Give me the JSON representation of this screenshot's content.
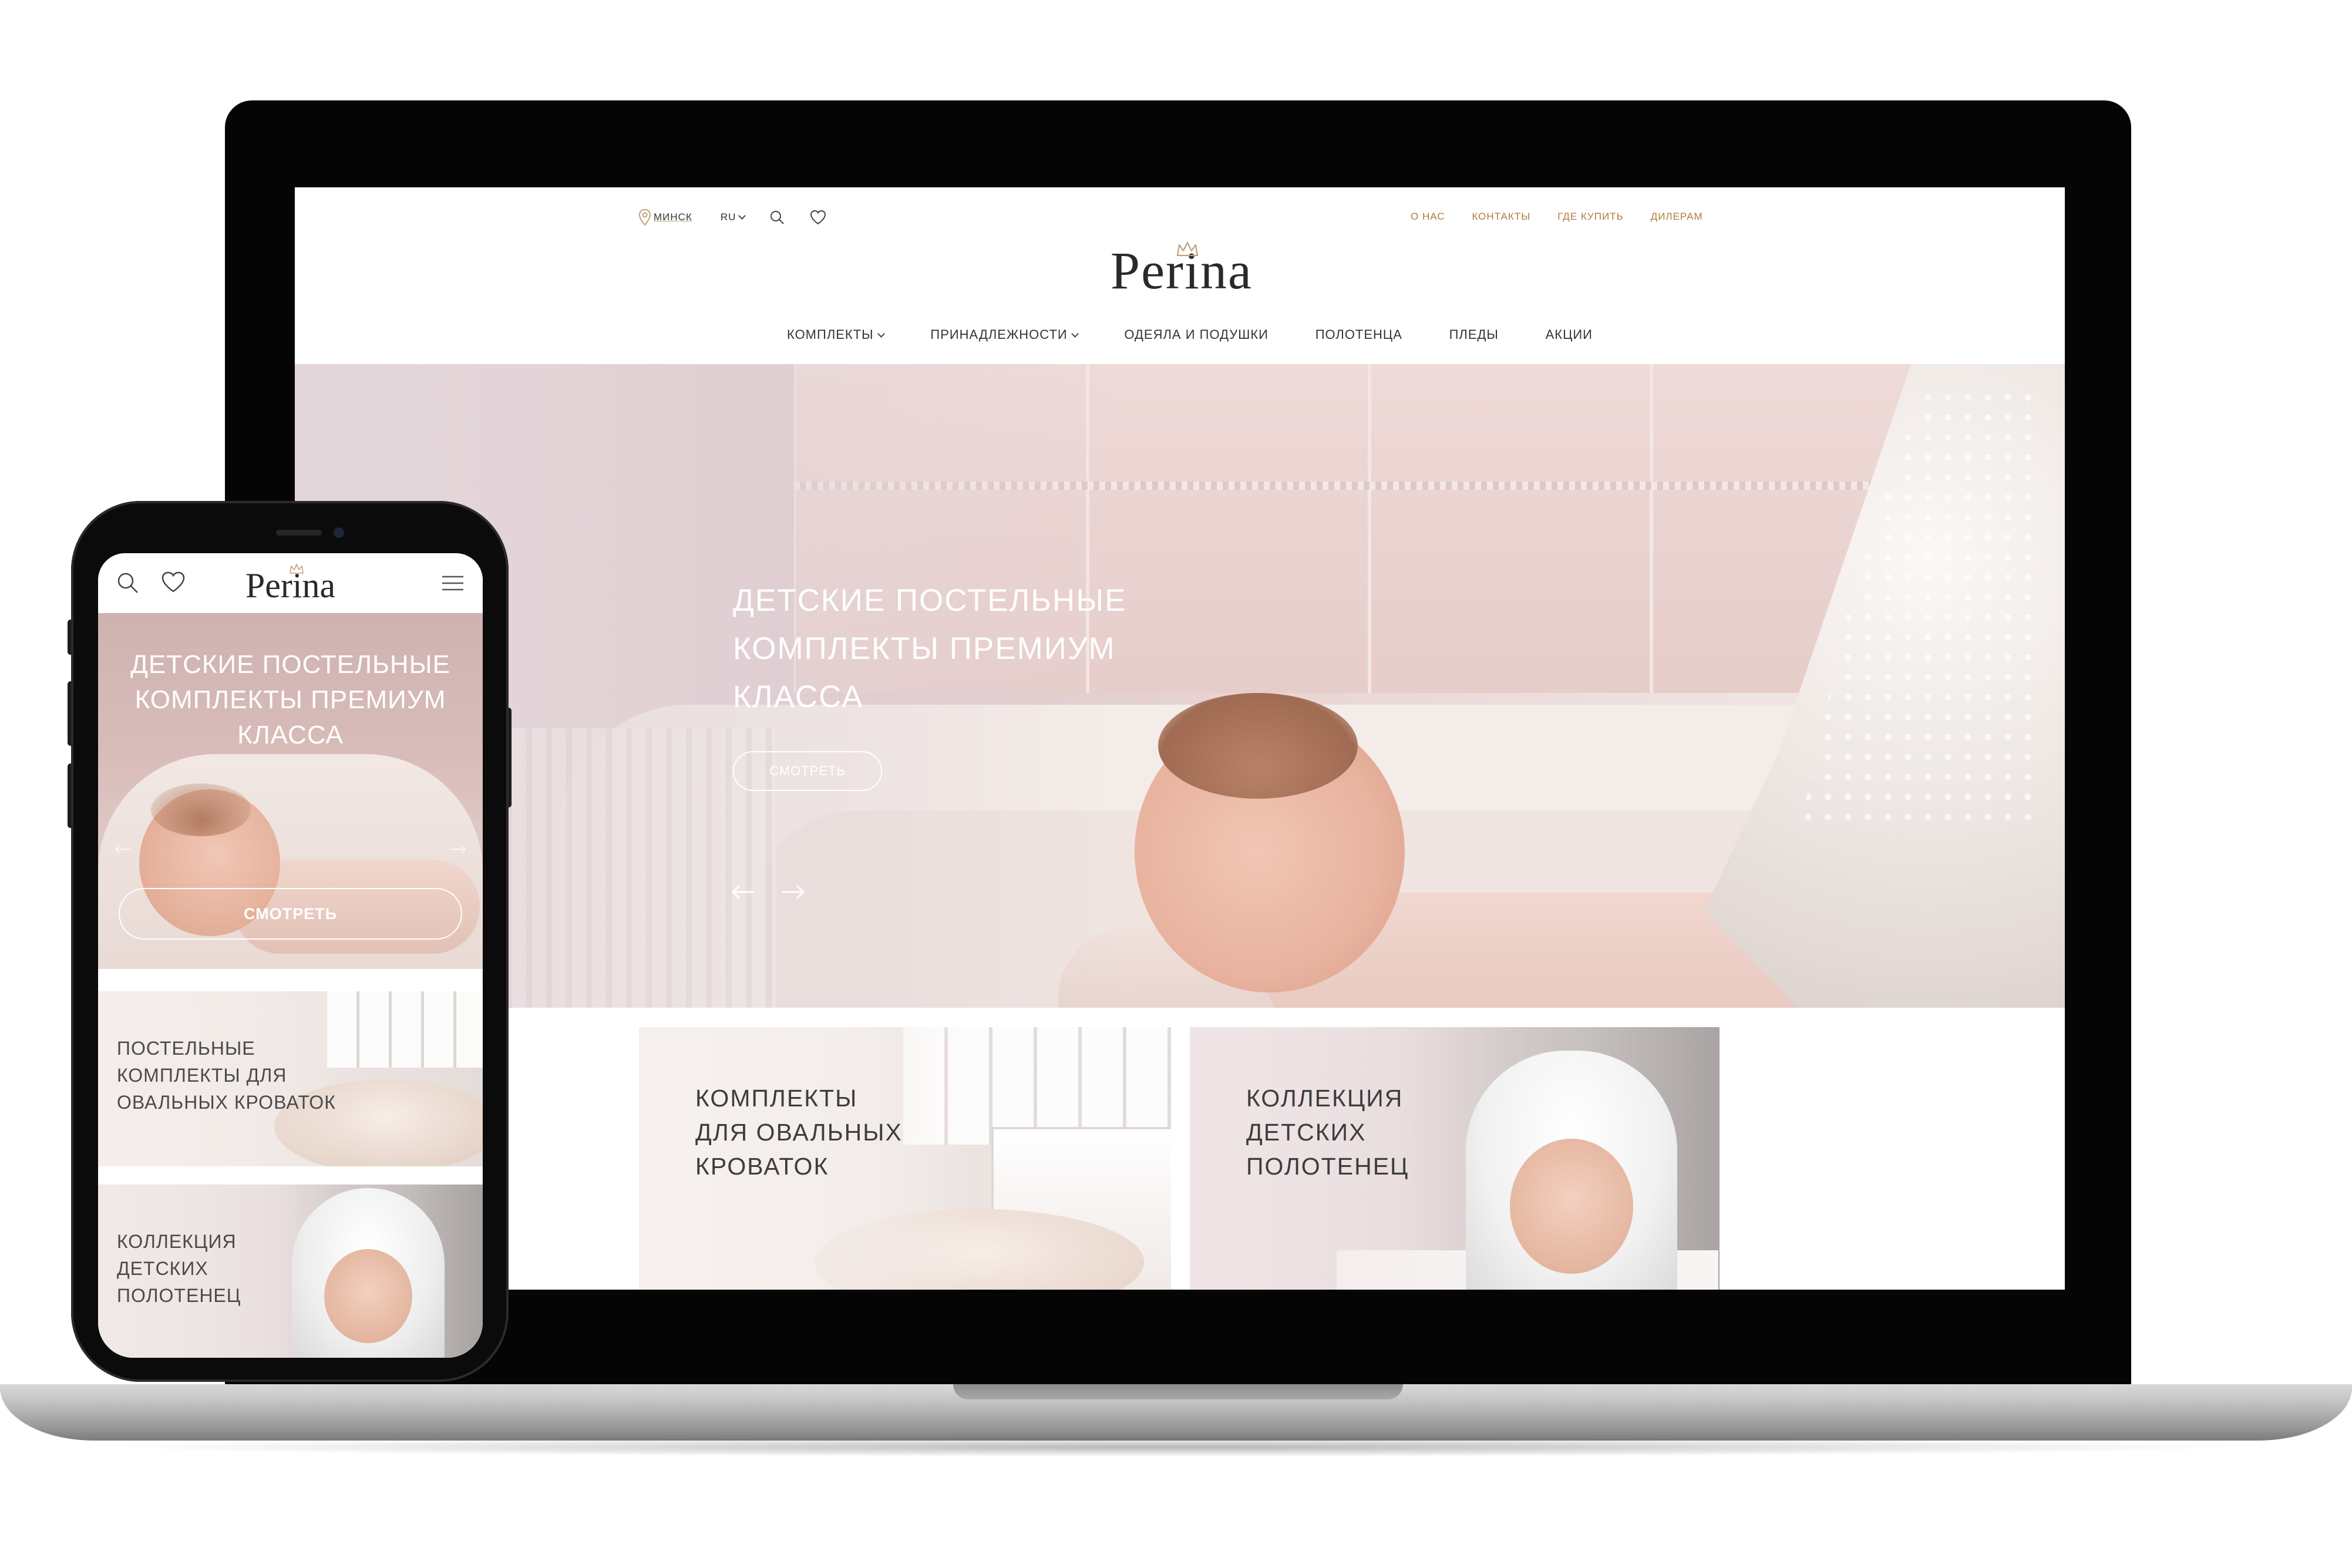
{
  "desktop": {
    "header": {
      "city": "МИНСК",
      "language": "RU",
      "links": [
        "О НАС",
        "КОНТАКТЫ",
        "ГДЕ КУПИТЬ",
        "ДИЛЕРАМ"
      ]
    },
    "logo": "Perina",
    "nav": [
      {
        "label": "КОМПЛЕКТЫ",
        "dropdown": true
      },
      {
        "label": "ПРИНАДЛЕЖНОСТИ",
        "dropdown": true
      },
      {
        "label": "ОДЕЯЛА И ПОДУШКИ",
        "dropdown": false
      },
      {
        "label": "ПОЛОТЕНЦА",
        "dropdown": false
      },
      {
        "label": "ПЛЕДЫ",
        "dropdown": false
      },
      {
        "label": "АКЦИИ",
        "dropdown": false
      }
    ],
    "hero": {
      "title_lines": [
        "ДЕТСКИЕ ПОСТЕЛЬНЫЕ",
        "КОМПЛЕКТЫ ПРЕМИУМ",
        "КЛАССА"
      ],
      "button": "СМОТРЕТЬ"
    },
    "cards": [
      {
        "lines": [
          "КОМПЛЕКТЫ",
          "ДЛЯ  ОВАЛЬНЫХ",
          "КРОВАТОК"
        ]
      },
      {
        "lines": [
          "КОЛЛЕКЦИЯ",
          "ДЕТСКИХ",
          "ПОЛОТЕНЕЦ"
        ]
      }
    ]
  },
  "mobile": {
    "logo": "Perina",
    "hero": {
      "title_lines": [
        "ДЕТСКИЕ ПОСТЕЛЬНЫЕ",
        "КОМПЛЕКТЫ ПРЕМИУМ",
        "КЛАССА"
      ],
      "button": "СМОТРЕТЬ"
    },
    "cards": [
      {
        "lines": [
          "ПОСТЕЛЬНЫЕ",
          "КОМПЛЕКТЫ ДЛЯ",
          "ОВАЛЬНЫХ КРОВАТОК"
        ]
      },
      {
        "lines": [
          "КОЛЛЕКЦИЯ",
          "ДЕТСКИХ",
          "ПОЛОТЕНЕЦ"
        ]
      }
    ]
  },
  "icons": {
    "location": "map-pin-icon",
    "search": "search-icon",
    "favorites": "heart-icon",
    "menu": "hamburger-menu-icon",
    "prev": "arrow-left-icon",
    "next": "arrow-right-icon",
    "logo_mark": "crown-icon"
  },
  "colors": {
    "accent_gold": "#b07a3c",
    "text_dark": "#333333",
    "hero_text": "#ffffff",
    "bezel": "#050505"
  }
}
